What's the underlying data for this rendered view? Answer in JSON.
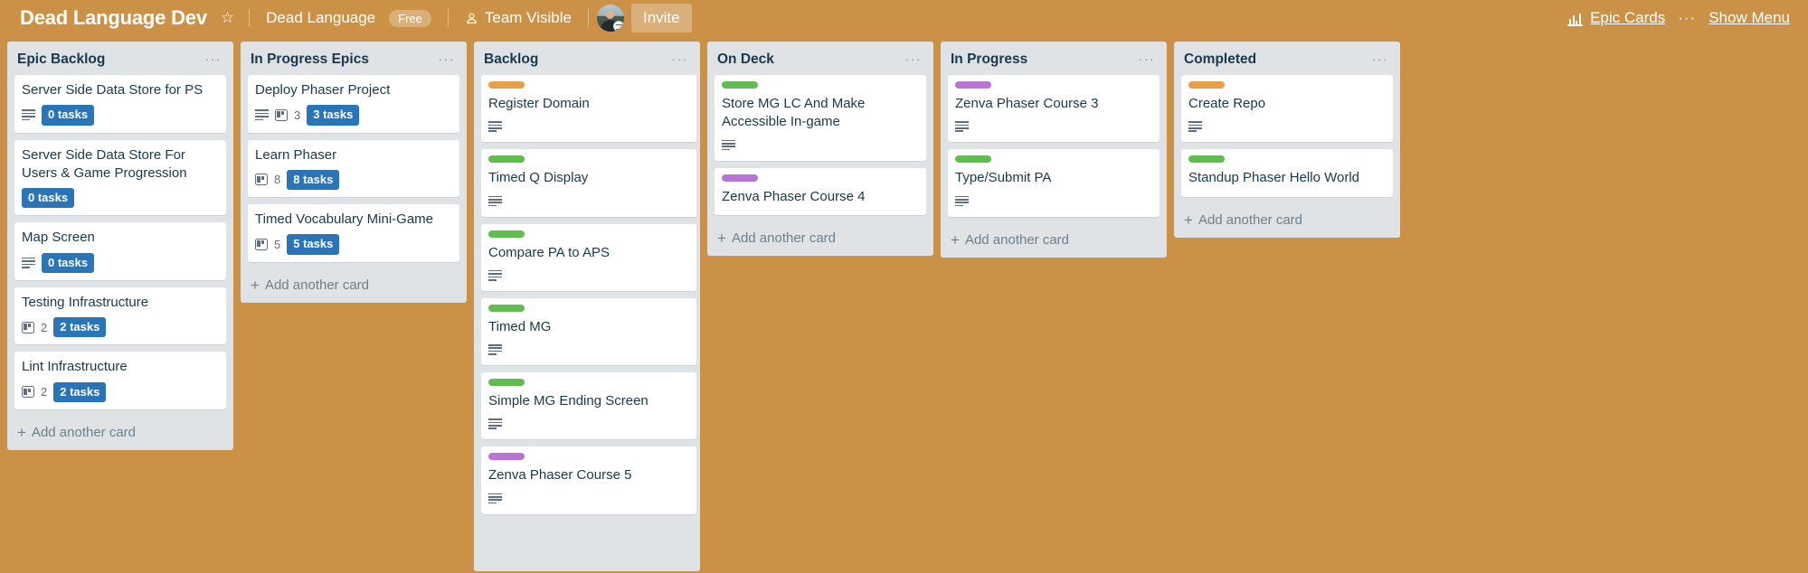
{
  "header": {
    "board_title": "Dead Language Dev",
    "star_icon": "star-icon",
    "team_name": "Dead Language",
    "plan_badge": "Free",
    "visibility_icon": "team-visibility-icon",
    "visibility": "Team Visible",
    "avatar_name": "member-avatar",
    "invite_label": "Invite",
    "butler_icon": "bar-chart-icon",
    "epic_cards_label": "Epic Cards",
    "overflow_label": "···",
    "show_menu_label": "Show Menu"
  },
  "colors": {
    "board_background": "#cb9247",
    "list_background": "#dfe3e6",
    "card_background": "#ffffff",
    "label_green": "#61bd4f",
    "label_orange": "#eb9f45",
    "label_purple": "#b975d6",
    "tasks_badge_blue": "#2a74b8",
    "title_text": "#17394d",
    "muted_text": "#5e6c84"
  },
  "add_card_label": "Add another card",
  "list_menu_label": "···",
  "lists": [
    {
      "title": "Epic Backlog",
      "scrollable": false,
      "show_add_card": true,
      "cards": [
        {
          "title": "Server Side Data Store for PS",
          "label": null,
          "has_description": true,
          "board_count": null,
          "tasks": "0 tasks"
        },
        {
          "title": "Server Side Data Store For Users & Game Progression",
          "label": null,
          "has_description": false,
          "board_count": null,
          "tasks": "0 tasks"
        },
        {
          "title": "Map Screen",
          "label": null,
          "has_description": true,
          "board_count": null,
          "tasks": "0 tasks"
        },
        {
          "title": "Testing Infrastructure",
          "label": null,
          "has_description": false,
          "board_count": "2",
          "tasks": "2 tasks"
        },
        {
          "title": "Lint Infrastructure",
          "label": null,
          "has_description": false,
          "board_count": "2",
          "tasks": "2 tasks"
        }
      ]
    },
    {
      "title": "In Progress Epics",
      "scrollable": false,
      "show_add_card": true,
      "cards": [
        {
          "title": "Deploy Phaser Project",
          "label": null,
          "has_description": true,
          "board_count": "3",
          "tasks": "3 tasks"
        },
        {
          "title": "Learn Phaser",
          "label": null,
          "has_description": false,
          "board_count": "8",
          "tasks": "8 tasks"
        },
        {
          "title": "Timed Vocabulary Mini-Game",
          "label": null,
          "has_description": false,
          "board_count": "5",
          "tasks": "5 tasks"
        }
      ]
    },
    {
      "title": "Backlog",
      "scrollable": true,
      "show_add_card": false,
      "cards": [
        {
          "title": "Register Domain",
          "label": "orange",
          "has_description": true,
          "board_count": null,
          "tasks": null
        },
        {
          "title": "Timed Q Display",
          "label": "green",
          "has_description": true,
          "board_count": null,
          "tasks": null
        },
        {
          "title": "Compare PA to APS",
          "label": "green",
          "has_description": true,
          "board_count": null,
          "tasks": null
        },
        {
          "title": "Timed MG",
          "label": "green",
          "has_description": true,
          "board_count": null,
          "tasks": null
        },
        {
          "title": "Simple MG Ending Screen",
          "label": "green",
          "has_description": true,
          "board_count": null,
          "tasks": null
        },
        {
          "title": "Zenva Phaser Course 5",
          "label": "purple",
          "has_description": true,
          "board_count": null,
          "tasks": null
        }
      ]
    },
    {
      "title": "On Deck",
      "scrollable": false,
      "show_add_card": true,
      "cards": [
        {
          "title": "Store MG LC And Make Accessible In-game",
          "label": "green",
          "has_description": true,
          "board_count": null,
          "tasks": null
        },
        {
          "title": "Zenva Phaser Course 4",
          "label": "purple",
          "has_description": false,
          "board_count": null,
          "tasks": null
        }
      ]
    },
    {
      "title": "In Progress",
      "scrollable": false,
      "show_add_card": true,
      "cards": [
        {
          "title": "Zenva Phaser Course 3",
          "label": "purple",
          "has_description": true,
          "board_count": null,
          "tasks": null
        },
        {
          "title": "Type/Submit PA",
          "label": "green",
          "has_description": true,
          "board_count": null,
          "tasks": null
        }
      ]
    },
    {
      "title": "Completed",
      "scrollable": false,
      "show_add_card": true,
      "cards": [
        {
          "title": "Create Repo",
          "label": "orange",
          "has_description": true,
          "board_count": null,
          "tasks": null
        },
        {
          "title": "Standup Phaser Hello World",
          "label": "green",
          "has_description": false,
          "board_count": null,
          "tasks": null
        }
      ]
    }
  ]
}
